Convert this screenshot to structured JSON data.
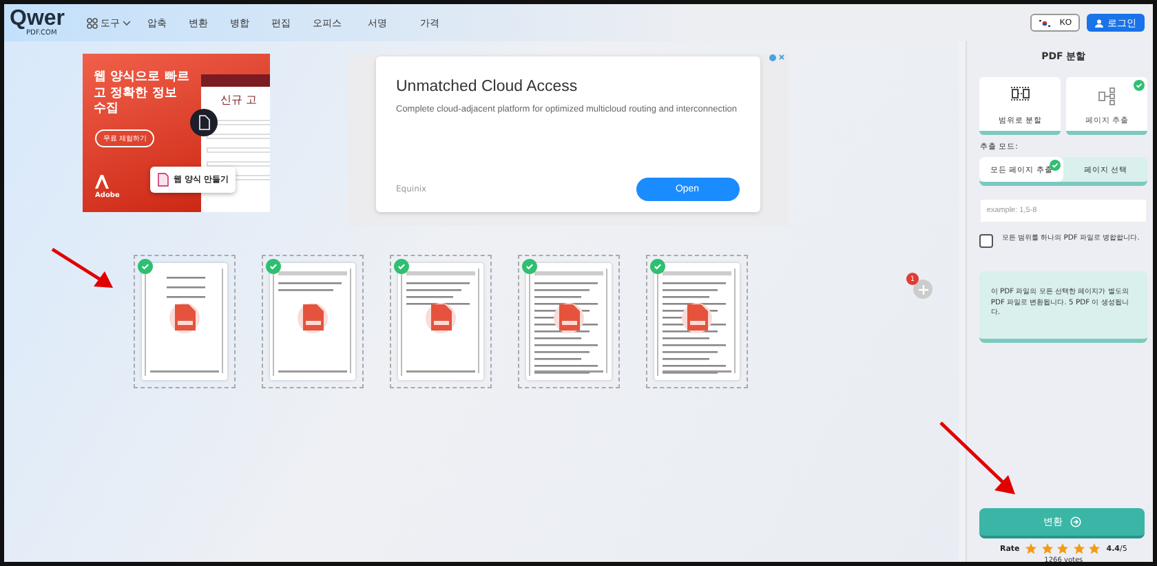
{
  "header": {
    "logo": {
      "word": "Qwer",
      "domain": "PDF.COM"
    },
    "nav": [
      {
        "label": "도구",
        "kind": "menu"
      },
      {
        "label": "압축",
        "kind": "link"
      },
      {
        "label": "변환",
        "kind": "link"
      },
      {
        "label": "병합",
        "kind": "link"
      },
      {
        "label": "편집",
        "kind": "link"
      },
      {
        "label": "오피스",
        "kind": "link"
      },
      {
        "label": "서명",
        "kind": "link"
      },
      {
        "label": "가격",
        "kind": "link"
      }
    ],
    "language": "KO",
    "login": "로그인"
  },
  "ads": {
    "left": {
      "headline": "웹 양식으로 빠르고 정확한 정보 수집",
      "cta": "무료 체험하기",
      "form_title": "신규 고",
      "chip": "웹 양식 만들기",
      "brand": "Adobe"
    },
    "right": {
      "title": "Unmatched Cloud Access",
      "text": "Complete cloud-adjacent platform for optimized multicloud routing and interconnection",
      "sponsor": "Equinix",
      "button": "Open"
    }
  },
  "add_badge": "1",
  "pages": [
    {
      "checked": true,
      "kind": "cover"
    },
    {
      "checked": true,
      "kind": "header"
    },
    {
      "checked": true,
      "kind": "table"
    },
    {
      "checked": true,
      "kind": "text"
    },
    {
      "checked": true,
      "kind": "text"
    }
  ],
  "panel": {
    "title": "PDF 분할",
    "modes": [
      {
        "label": "범위로 분할",
        "selected": false,
        "kind": "range"
      },
      {
        "label": "페이지 추출",
        "selected": true,
        "kind": "extract"
      }
    ],
    "extract_label": "추출 모드:",
    "extract_options": [
      {
        "label": "모든 페이지 추출",
        "selected": true
      },
      {
        "label": "페이지 선택",
        "selected": false
      }
    ],
    "range_field": {
      "placeholder": "example: 1,5-8"
    },
    "merge": {
      "label": "모든 범위를 하나의 PDF 파일로 병합합니다.",
      "checked": false
    },
    "info": "이 PDF 파일의 모든 선택한 페이지가 별도의 PDF 파일로 변환됩니다. 5 PDF 이 생성됩니다.",
    "convert": "변환",
    "rating": {
      "label": "Rate",
      "stars": 5,
      "score": "4.4",
      "max": "/5",
      "votes": "1266 votes"
    }
  }
}
